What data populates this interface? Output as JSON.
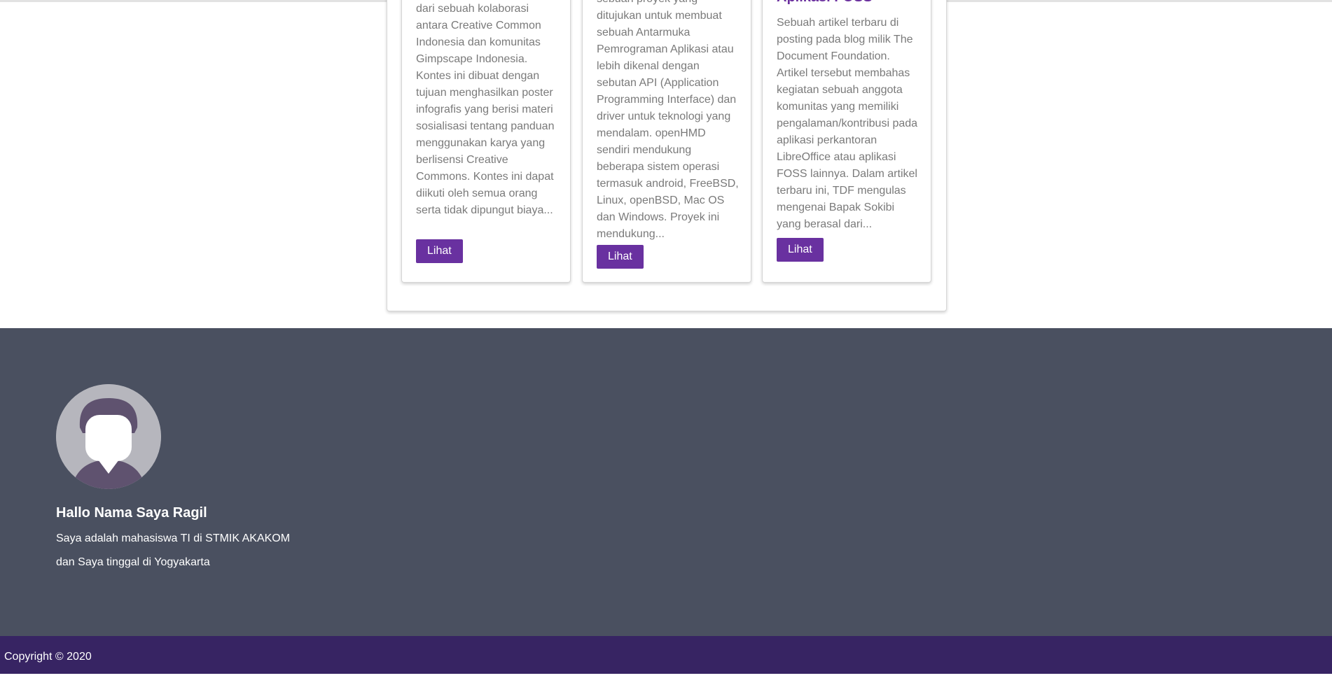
{
  "cards": [
    {
      "text": "Kreatif Berbagi, Kita Berkarya, Kita Merdeka lahir dari sebuah kolaborasi antara Creative Common Indonesia dan komunitas Gimpscape Indonesia. Kontes ini dibuat dengan tujuan menghasilkan poster infografis yang berisi materi sosialisasi tentang panduan menggunakan karya yang berlisensi Creative Commons. Kontes ini dapat diikuti oleh semua orang serta tidak dipungut biaya...",
      "button": "Lihat"
    },
    {
      "text": "OpenHMD merupakan sebuah proyek yang ditujukan untuk membuat sebuah Antarmuka Pemrograman Aplikasi atau lebih dikenal dengan sebutan API (Application Programming Interface) dan driver untuk teknologi yang mendalam. openHMD sendiri mendukung beberapa sistem operasi termasuk android, FreeBSD, Linux, openBSD, Mac OS dan Windows. Proyek ini mendukung...",
      "button": "Lihat"
    },
    {
      "title": "Aplikasi FOSS",
      "text": "Sebuah artikel terbaru di posting pada blog milik The Document Foundation. Artikel tersebut membahas kegiatan sebuah anggota komunitas yang memiliki pengalaman/kontribusi pada aplikasi perkantoran LibreOffice atau aplikasi FOSS lainnya. Dalam artikel terbaru ini, TDF mengulas mengenai Bapak Sokibi yang berasal dari...",
      "button": "Lihat"
    }
  ],
  "footer": {
    "avatar_icon": "user-avatar-icon",
    "name": "Hallo Nama Saya Ragil",
    "line1": "Saya adalah mahasiswa TI di STMIK AKAKOM",
    "line2": "dan Saya tinggal di Yogyakarta"
  },
  "copyright": "Copyright © 2020",
  "colors": {
    "accent": "#6931a0",
    "footer_bg": "#4a5060",
    "bottom_bar_bg": "#372463"
  }
}
